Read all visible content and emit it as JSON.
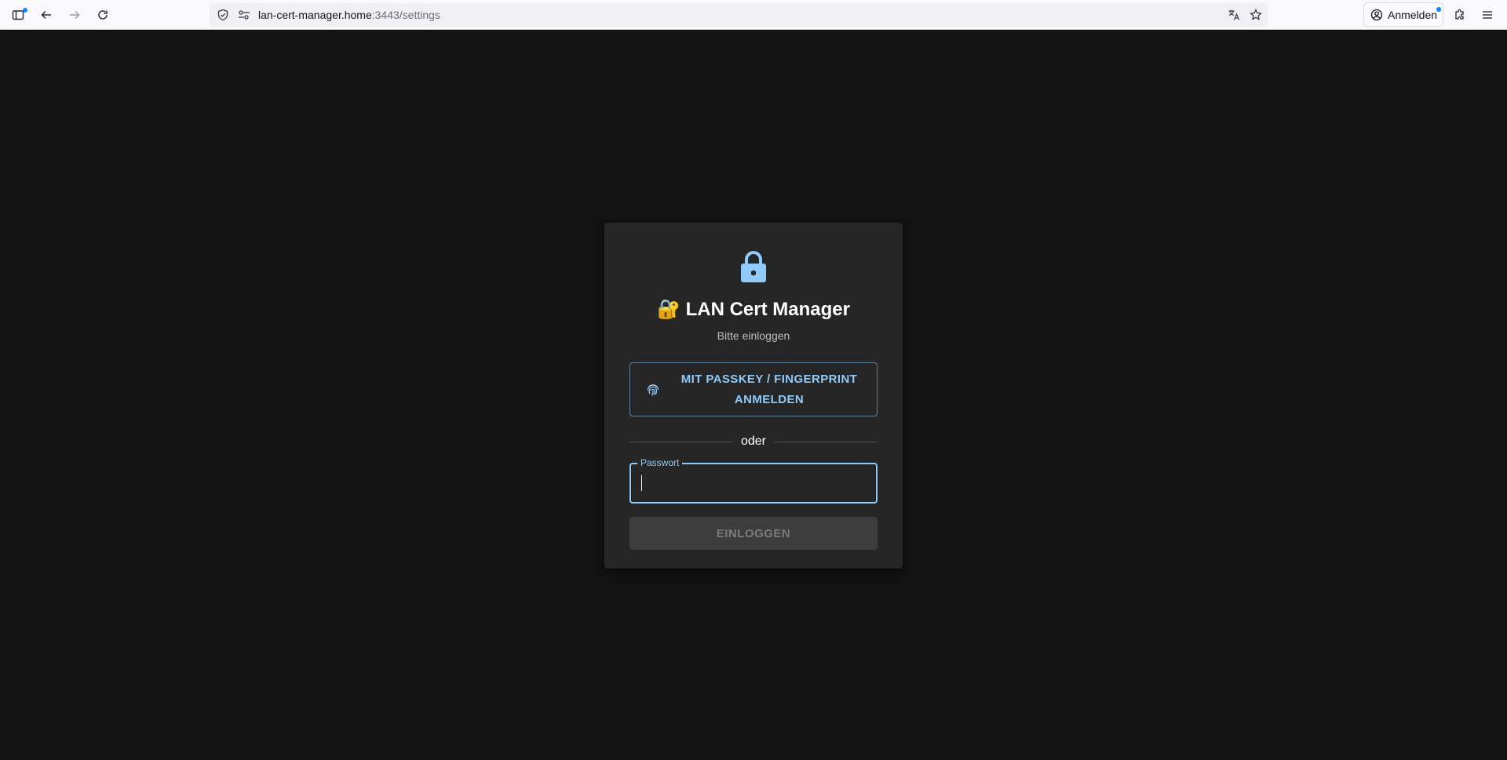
{
  "browser": {
    "url_host": "lan-cert-manager.home",
    "url_rest": ":3443/settings",
    "signin_label": "Anmelden",
    "accent": "#0a84ff"
  },
  "login": {
    "title": "🔐 LAN Cert Manager",
    "subtitle": "Bitte einloggen",
    "passkey_line1": "MIT PASSKEY / FINGERPRINT",
    "passkey_line2": "ANMELDEN",
    "divider_text": "oder",
    "password_label": "Passwort",
    "password_value": "",
    "submit_label": "EINLOGGEN",
    "accent": "#90caf9"
  },
  "icons": {
    "sidebar": "sidebar-icon",
    "back": "arrow-left-icon",
    "forward": "arrow-right-icon",
    "reload": "reload-icon",
    "tracking": "shield-icon",
    "permissions": "permissions-icon",
    "translate": "translate-icon",
    "bookmark": "star-icon",
    "account": "account-icon",
    "extensions": "puzzle-icon",
    "menu": "hamburger-icon",
    "lock": "lock-icon",
    "fingerprint": "fingerprint-icon"
  }
}
